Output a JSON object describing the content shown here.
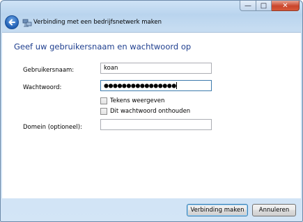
{
  "window": {
    "caption_buttons": {
      "minimize": "—",
      "maximize": "□",
      "close": "✕"
    }
  },
  "nav": {
    "title": "Verbinding met een bedrijfsnetwerk maken",
    "back_icon": "back-arrow-icon",
    "network_icon": "network-icon"
  },
  "main": {
    "heading": "Geef uw gebruikersnaam en wachtwoord op",
    "username_label": "Gebruikersnaam:",
    "username_value": "koan",
    "password_label": "Wachtwoord:",
    "password_value": "●●●●●●●●●●●●●●●●",
    "show_chars_label": "Tekens weergeven",
    "show_chars_checked": false,
    "remember_label": "Dit wachtwoord onthouden",
    "remember_checked": false,
    "domain_label": "Domein (optioneel):",
    "domain_value": ""
  },
  "footer": {
    "connect_label": "Verbinding maken",
    "cancel_label": "Annuleren"
  },
  "colors": {
    "heading": "#1e3e8e",
    "frame": "#c6dcf1",
    "close_button": "#c9452b"
  }
}
